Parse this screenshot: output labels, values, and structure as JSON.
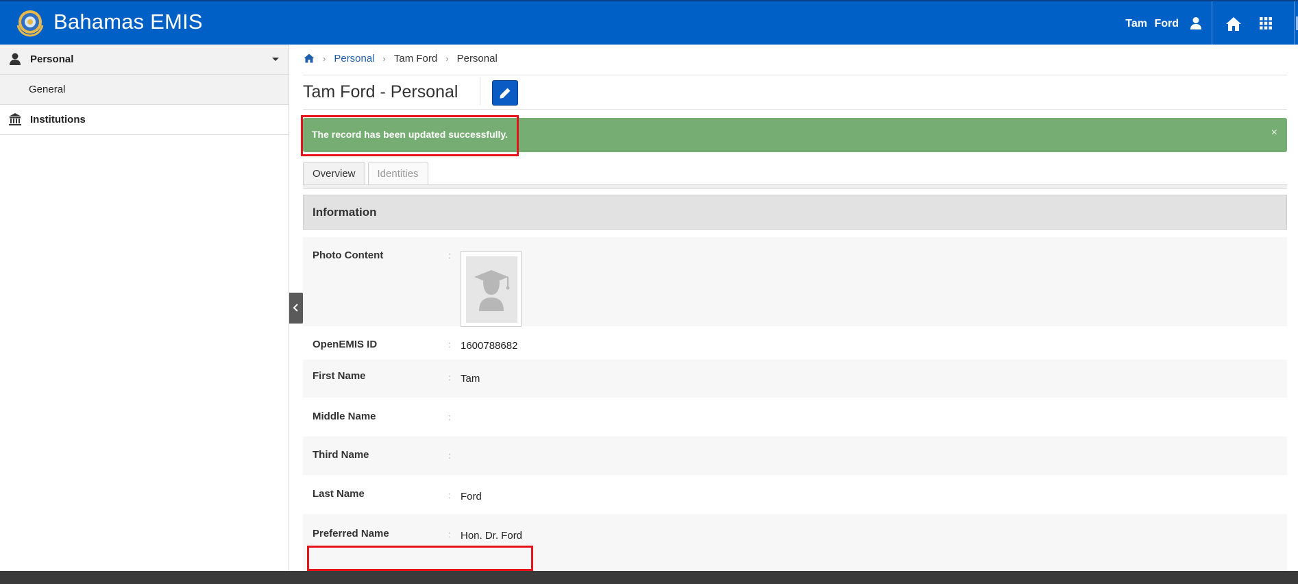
{
  "app": {
    "brand": "Bahamas EMIS",
    "user_first": "Tam",
    "user_last": "Ford",
    "accent_color": "#0060c6",
    "icons": {
      "logo": "emis-seal-icon",
      "user": "user-icon",
      "home": "home-icon",
      "apps": "grid-icon"
    }
  },
  "sidebar": {
    "items": [
      {
        "label": "Personal",
        "icon": "user-icon",
        "expanded": true
      },
      {
        "label": "General"
      },
      {
        "label": "Institutions",
        "icon": "bank-icon"
      }
    ]
  },
  "breadcrumb": {
    "items": [
      {
        "label": "Personal",
        "link": true
      },
      {
        "label": "Tam Ford",
        "link": false
      },
      {
        "label": "Personal",
        "link": false
      }
    ]
  },
  "page": {
    "title": "Tam Ford - Personal"
  },
  "alert": {
    "message": "The record has been updated successfully.",
    "close": "×",
    "color": "#76ad72"
  },
  "tabs": [
    {
      "label": "Overview",
      "active": true
    },
    {
      "label": "Identities",
      "active": false
    }
  ],
  "info": {
    "heading": "Information",
    "colon": ":",
    "fields": [
      {
        "label": "Photo Content",
        "value": ""
      },
      {
        "label": "OpenEMIS ID",
        "value": "1600788682"
      },
      {
        "label": "First Name",
        "value": "Tam"
      },
      {
        "label": "Middle Name",
        "value": ""
      },
      {
        "label": "Third Name",
        "value": ""
      },
      {
        "label": "Last Name",
        "value": "Ford"
      },
      {
        "label": "Preferred Name",
        "value": "Hon. Dr. Ford"
      }
    ]
  },
  "highlight_color": "#e5141b"
}
